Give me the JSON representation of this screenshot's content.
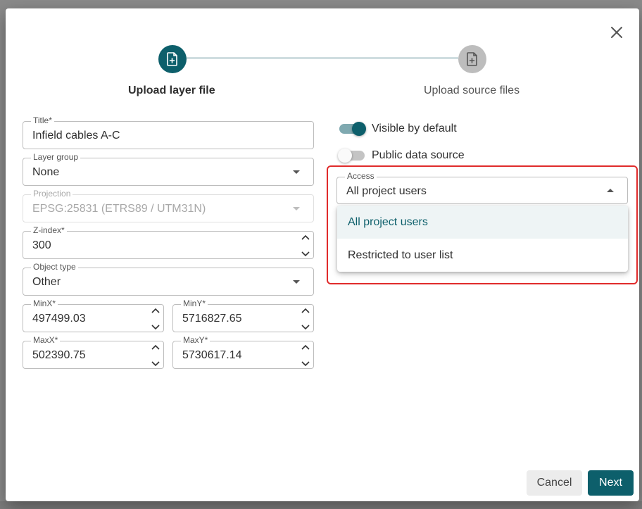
{
  "stepper": {
    "steps": [
      {
        "label": "Upload layer file",
        "icon": "file-plus-icon",
        "state": "active"
      },
      {
        "label": "Upload source files",
        "icon": "file-plus-icon",
        "state": "inactive"
      }
    ]
  },
  "form": {
    "title": {
      "label": "Title*",
      "value": "Infield cables A-C"
    },
    "layer_group": {
      "label": "Layer group",
      "value": "None"
    },
    "projection": {
      "label": "Projection",
      "value": "EPSG:25831 (ETRS89 / UTM31N)",
      "disabled": true
    },
    "z_index": {
      "label": "Z-index*",
      "value": "300"
    },
    "object_type": {
      "label": "Object type",
      "value": "Other"
    },
    "min_x": {
      "label": "MinX*",
      "value": "497499.03"
    },
    "min_y": {
      "label": "MinY*",
      "value": "5716827.65"
    },
    "max_x": {
      "label": "MaxX*",
      "value": "502390.75"
    },
    "max_y": {
      "label": "MaxY*",
      "value": "5730617.14"
    }
  },
  "options": {
    "visible_by_default": {
      "label": "Visible by default",
      "checked": true
    },
    "public_data_source": {
      "label": "Public data source",
      "checked": false
    },
    "access": {
      "label": "Access",
      "value": "All project users",
      "options": [
        "All project users",
        "Restricted to user list"
      ]
    }
  },
  "footer": {
    "cancel_label": "Cancel",
    "next_label": "Next"
  },
  "colors": {
    "accent": "#0d5f6b",
    "highlight": "#e02b2b"
  }
}
